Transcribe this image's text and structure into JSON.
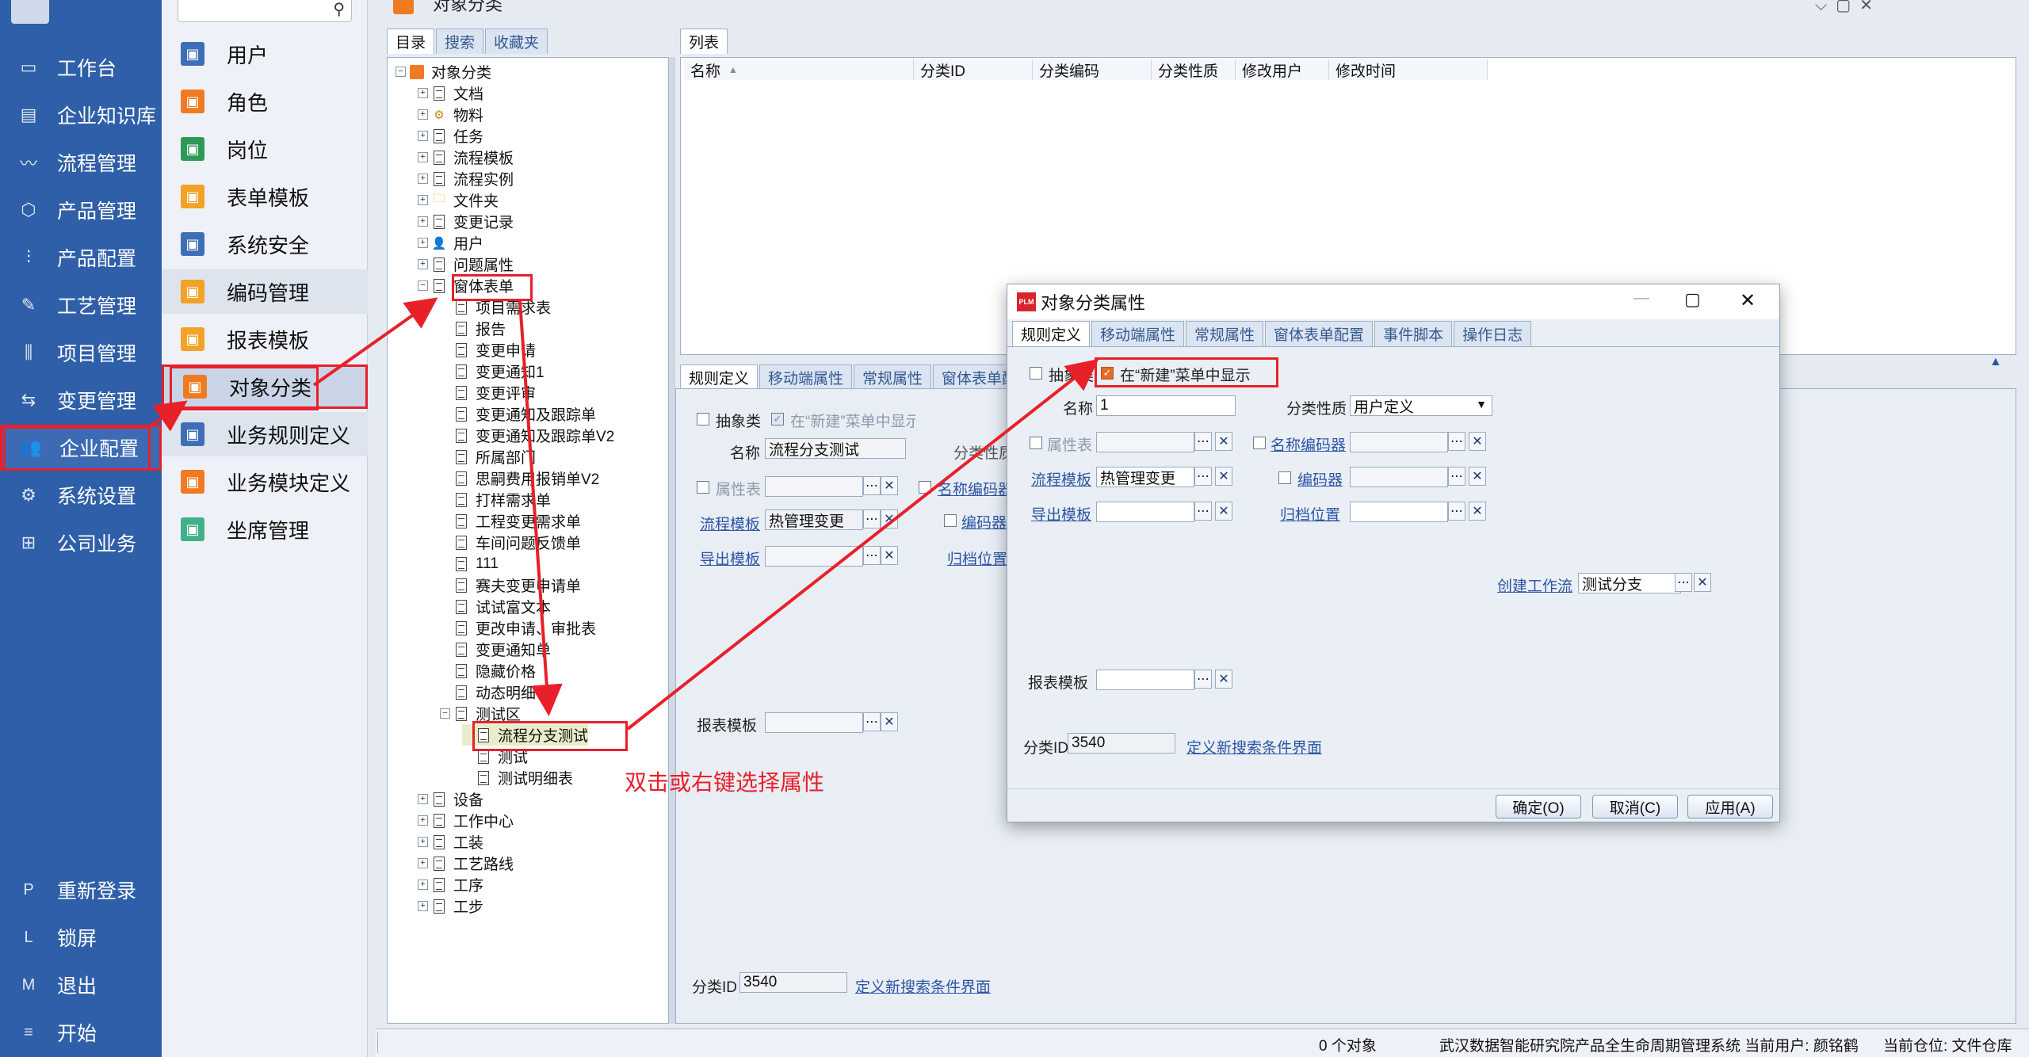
{
  "window_title": "对象分类",
  "nav": {
    "items": [
      {
        "label": "工作台",
        "icon": "monitor-icon"
      },
      {
        "label": "企业知识库",
        "icon": "book-icon"
      },
      {
        "label": "流程管理",
        "icon": "flow-icon"
      },
      {
        "label": "产品管理",
        "icon": "cube-icon"
      },
      {
        "label": "产品配置",
        "icon": "sliders-icon"
      },
      {
        "label": "工艺管理",
        "icon": "wrench-icon"
      },
      {
        "label": "项目管理",
        "icon": "chart-icon"
      },
      {
        "label": "变更管理",
        "icon": "swap-icon"
      },
      {
        "label": "企业配置",
        "icon": "users-icon"
      },
      {
        "label": "系统设置",
        "icon": "gear-icon"
      },
      {
        "label": "公司业务",
        "icon": "grid-icon"
      }
    ],
    "bottom": [
      {
        "key": "P",
        "label": "重新登录"
      },
      {
        "key": "L",
        "label": "锁屏"
      },
      {
        "key": "M",
        "label": "退出"
      },
      {
        "key": "≡",
        "label": "开始"
      }
    ]
  },
  "sub": {
    "items": [
      {
        "label": "用户",
        "color": "#3e6fb6"
      },
      {
        "label": "角色",
        "color": "#f07a22"
      },
      {
        "label": "岗位",
        "color": "#2f9a57"
      },
      {
        "label": "表单模板",
        "color": "#f2a227"
      },
      {
        "label": "系统安全",
        "color": "#3e6fb6"
      },
      {
        "label": "编码管理",
        "color": "#f2a227"
      },
      {
        "label": "报表模板",
        "color": "#f2a227"
      },
      {
        "label": "对象分类",
        "color": "#f07a22"
      },
      {
        "label": "业务规则定义",
        "color": "#3e6fb6"
      },
      {
        "label": "业务模块定义",
        "color": "#f07a22"
      },
      {
        "label": "坐席管理",
        "color": "#44b08a"
      }
    ]
  },
  "left_tabs": [
    "目录",
    "搜索",
    "收藏夹"
  ],
  "tree": [
    {
      "label": "对象分类",
      "depth": 0,
      "exp": "−"
    },
    {
      "label": "文档",
      "depth": 1,
      "exp": "+"
    },
    {
      "label": "物料",
      "depth": 1,
      "exp": "+"
    },
    {
      "label": "任务",
      "depth": 1,
      "exp": "+"
    },
    {
      "label": "流程模板",
      "depth": 1,
      "exp": "+"
    },
    {
      "label": "流程实例",
      "depth": 1,
      "exp": "+"
    },
    {
      "label": "文件夹",
      "depth": 1,
      "exp": "+"
    },
    {
      "label": "变更记录",
      "depth": 1,
      "exp": "+"
    },
    {
      "label": "用户",
      "depth": 1,
      "exp": "+"
    },
    {
      "label": "问题属性",
      "depth": 1,
      "exp": "+"
    },
    {
      "label": "窗体表单",
      "depth": 1,
      "exp": "−"
    },
    {
      "label": "项目需求表",
      "depth": 2,
      "exp": ""
    },
    {
      "label": "报告",
      "depth": 2,
      "exp": ""
    },
    {
      "label": "变更申请",
      "depth": 2,
      "exp": ""
    },
    {
      "label": "变更通知1",
      "depth": 2,
      "exp": ""
    },
    {
      "label": "变更评审",
      "depth": 2,
      "exp": ""
    },
    {
      "label": "变更通知及跟踪单",
      "depth": 2,
      "exp": ""
    },
    {
      "label": "变更通知及跟踪单V2",
      "depth": 2,
      "exp": ""
    },
    {
      "label": "所属部门",
      "depth": 2,
      "exp": ""
    },
    {
      "label": "思嗣费用报销单V2",
      "depth": 2,
      "exp": ""
    },
    {
      "label": "打样需求单",
      "depth": 2,
      "exp": ""
    },
    {
      "label": "工程变更需求单",
      "depth": 2,
      "exp": ""
    },
    {
      "label": "车间问题反馈单",
      "depth": 2,
      "exp": ""
    },
    {
      "label": "111",
      "depth": 2,
      "exp": ""
    },
    {
      "label": "赛夫变更申请单",
      "depth": 2,
      "exp": ""
    },
    {
      "label": "试试富文本",
      "depth": 2,
      "exp": ""
    },
    {
      "label": "更改申请、审批表",
      "depth": 2,
      "exp": ""
    },
    {
      "label": "变更通知单",
      "depth": 2,
      "exp": ""
    },
    {
      "label": "隐藏价格",
      "depth": 2,
      "exp": ""
    },
    {
      "label": "动态明细",
      "depth": 2,
      "exp": ""
    },
    {
      "label": "测试区",
      "depth": 2,
      "exp": "−"
    },
    {
      "label": "流程分支测试",
      "depth": 3,
      "exp": ""
    },
    {
      "label": "测试",
      "depth": 3,
      "exp": ""
    },
    {
      "label": "测试明细表",
      "depth": 3,
      "exp": ""
    },
    {
      "label": "设备",
      "depth": 1,
      "exp": "+"
    },
    {
      "label": "工作中心",
      "depth": 1,
      "exp": "+"
    },
    {
      "label": "工装",
      "depth": 1,
      "exp": "+"
    },
    {
      "label": "工艺路线",
      "depth": 1,
      "exp": "+"
    },
    {
      "label": "工序",
      "depth": 1,
      "exp": "+"
    },
    {
      "label": "工步",
      "depth": 1,
      "exp": "+"
    }
  ],
  "list": {
    "tab": "列表",
    "columns": [
      "名称",
      "分类ID",
      "分类编码",
      "分类性质",
      "修改用户",
      "修改时间"
    ]
  },
  "lower_tabs": [
    "规则定义",
    "移动端属性",
    "常规属性",
    "窗体表单配"
  ],
  "bg_form": {
    "abstract": "抽象类",
    "show_new": "在“新建”菜单中显示",
    "name_label": "名称",
    "name_value": "流程分支测试",
    "nature_label": "分类性质",
    "attr_table": "属性表",
    "name_coder": "名称编码器",
    "flow_template": "流程模板",
    "flow_template_value": "热管理变更",
    "coder": "编码器",
    "export_template": "导出模板",
    "archive": "归档位置",
    "report_template": "报表模板",
    "id_label": "分类ID",
    "id_value": "3540",
    "define_search": "定义新搜索条件界面"
  },
  "dialog": {
    "title": "对象分类属性",
    "tabs": [
      "规则定义",
      "移动端属性",
      "常规属性",
      "窗体表单配置",
      "事件脚本",
      "操作日志"
    ],
    "abstract": "抽象类",
    "show_new": "在“新建”菜单中显示",
    "name_label": "名称",
    "name_value": "1",
    "nature_label": "分类性质",
    "nature_value": "用户定义",
    "attr_table": "属性表",
    "name_coder": "名称编码器",
    "flow_template": "流程模板",
    "flow_template_value": "热管理变更",
    "coder": "编码器",
    "export_template": "导出模板",
    "archive": "归档位置",
    "create_workflow": "创建工作流",
    "create_workflow_value": "测试分支",
    "report_template": "报表模板",
    "id_label": "分类ID",
    "id_value": "3540",
    "define_search": "定义新搜索条件界面",
    "ok": "确定(O)",
    "cancel": "取消(C)",
    "apply": "应用(A)"
  },
  "annotation": "双击或右键选择属性",
  "status": {
    "count": "0 个对象",
    "info": "武汉数据智能研究院产品全生命周期管理系统 当前用户: 颜铭鹤",
    "location": "当前仓位: 文件仓库"
  },
  "colors": {
    "nav_bg": "#2f5fa8",
    "highlight": "#e8202a",
    "accent": "#f07a22"
  }
}
